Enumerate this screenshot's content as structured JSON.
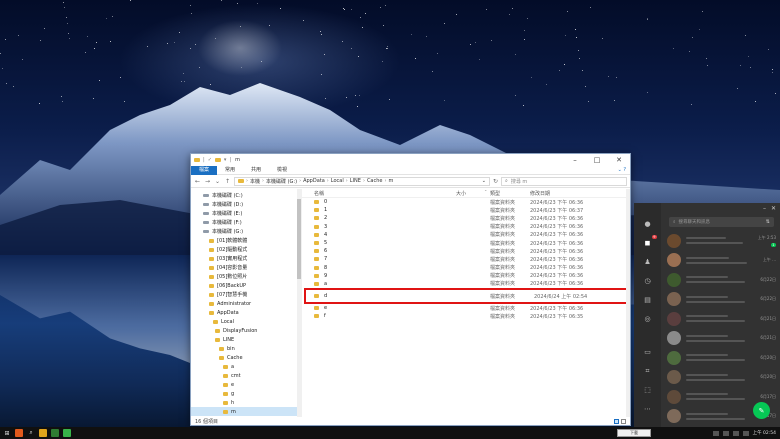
{
  "explorer": {
    "title": "m",
    "ribbon_tabs": [
      "檔案",
      "常用",
      "共用",
      "檢視"
    ],
    "address": [
      "本機",
      "本機磁碟 (G:)",
      "AppData",
      "Local",
      "LINE",
      "Cache",
      "m"
    ],
    "search_placeholder": "搜尋 m",
    "columns": {
      "name": "名稱",
      "size": "大小",
      "type": "類型",
      "date": "修改日期"
    },
    "tree": [
      {
        "label": "本機磁碟 (C:)",
        "kind": "drive"
      },
      {
        "label": "本機磁碟 (D:)",
        "kind": "drive"
      },
      {
        "label": "本機磁碟 (E:)",
        "kind": "drive"
      },
      {
        "label": "本機磁碟 (F:)",
        "kind": "drive"
      },
      {
        "label": "本機磁碟 (G:)",
        "kind": "drive"
      },
      {
        "label": "[01]軟體軟體",
        "kind": "folder"
      },
      {
        "label": "[02]驅動程式",
        "kind": "folder"
      },
      {
        "label": "[03]實用程式",
        "kind": "folder"
      },
      {
        "label": "[04]容影音量",
        "kind": "folder"
      },
      {
        "label": "[05]數位照片",
        "kind": "folder"
      },
      {
        "label": "[06]BackUP",
        "kind": "folder"
      },
      {
        "label": "[07]智慧手機",
        "kind": "folder"
      },
      {
        "label": "Administrator",
        "kind": "folder"
      },
      {
        "label": "AppData",
        "kind": "folder"
      },
      {
        "label": "Local",
        "kind": "folder"
      },
      {
        "label": "DisplayFusion",
        "kind": "folder"
      },
      {
        "label": "LINE",
        "kind": "folder"
      },
      {
        "label": "bin",
        "kind": "folder"
      },
      {
        "label": "Cache",
        "kind": "folder"
      },
      {
        "label": "a",
        "kind": "folder"
      },
      {
        "label": "cmt",
        "kind": "folder"
      },
      {
        "label": "e",
        "kind": "folder"
      },
      {
        "label": "g",
        "kind": "folder"
      },
      {
        "label": "h",
        "kind": "folder"
      },
      {
        "label": "m",
        "kind": "folder",
        "selected": true
      }
    ],
    "files": [
      {
        "name": "0",
        "type": "檔案資料夾",
        "date": "2024/6/23 下午 06:36"
      },
      {
        "name": "1",
        "type": "檔案資料夾",
        "date": "2024/6/23 下午 06:37"
      },
      {
        "name": "2",
        "type": "檔案資料夾",
        "date": "2024/6/23 下午 06:36"
      },
      {
        "name": "3",
        "type": "檔案資料夾",
        "date": "2024/6/23 下午 06:36"
      },
      {
        "name": "4",
        "type": "檔案資料夾",
        "date": "2024/6/23 下午 06:36"
      },
      {
        "name": "5",
        "type": "檔案資料夾",
        "date": "2024/6/23 下午 06:36"
      },
      {
        "name": "6",
        "type": "檔案資料夾",
        "date": "2024/6/23 下午 06:36"
      },
      {
        "name": "7",
        "type": "檔案資料夾",
        "date": "2024/6/23 下午 06:36"
      },
      {
        "name": "8",
        "type": "檔案資料夾",
        "date": "2024/6/23 下午 06:36"
      },
      {
        "name": "9",
        "type": "檔案資料夾",
        "date": "2024/6/23 下午 06:36"
      },
      {
        "name": "a",
        "type": "檔案資料夾",
        "date": "2024/6/23 下午 06:36"
      },
      {
        "name": "d",
        "type": "檔案資料夾",
        "date": "2024/6/24 上午 02:54",
        "highlight": true
      },
      {
        "name": "e",
        "type": "檔案資料夾",
        "date": "2024/6/23 下午 06:36"
      },
      {
        "name": "f",
        "type": "檔案資料夾",
        "date": "2024/6/23 下午 06:35"
      }
    ],
    "status": "16 個項目"
  },
  "line": {
    "search_placeholder": "搜尋聊天和訊息",
    "rail_badge": "9",
    "chats": [
      {
        "time": "上午 2:53",
        "unread": "1"
      },
      {
        "time": "上午 ..."
      },
      {
        "time": "6月22日"
      },
      {
        "time": "6月22日"
      },
      {
        "time": "6月21日"
      },
      {
        "time": "6月21日"
      },
      {
        "time": "6月20日"
      },
      {
        "time": "6月20日"
      },
      {
        "time": "6月17日"
      },
      {
        "time": "6月17日"
      }
    ]
  },
  "taskbar": {
    "ime_label": "下載",
    "clock": "上午 02:54"
  }
}
